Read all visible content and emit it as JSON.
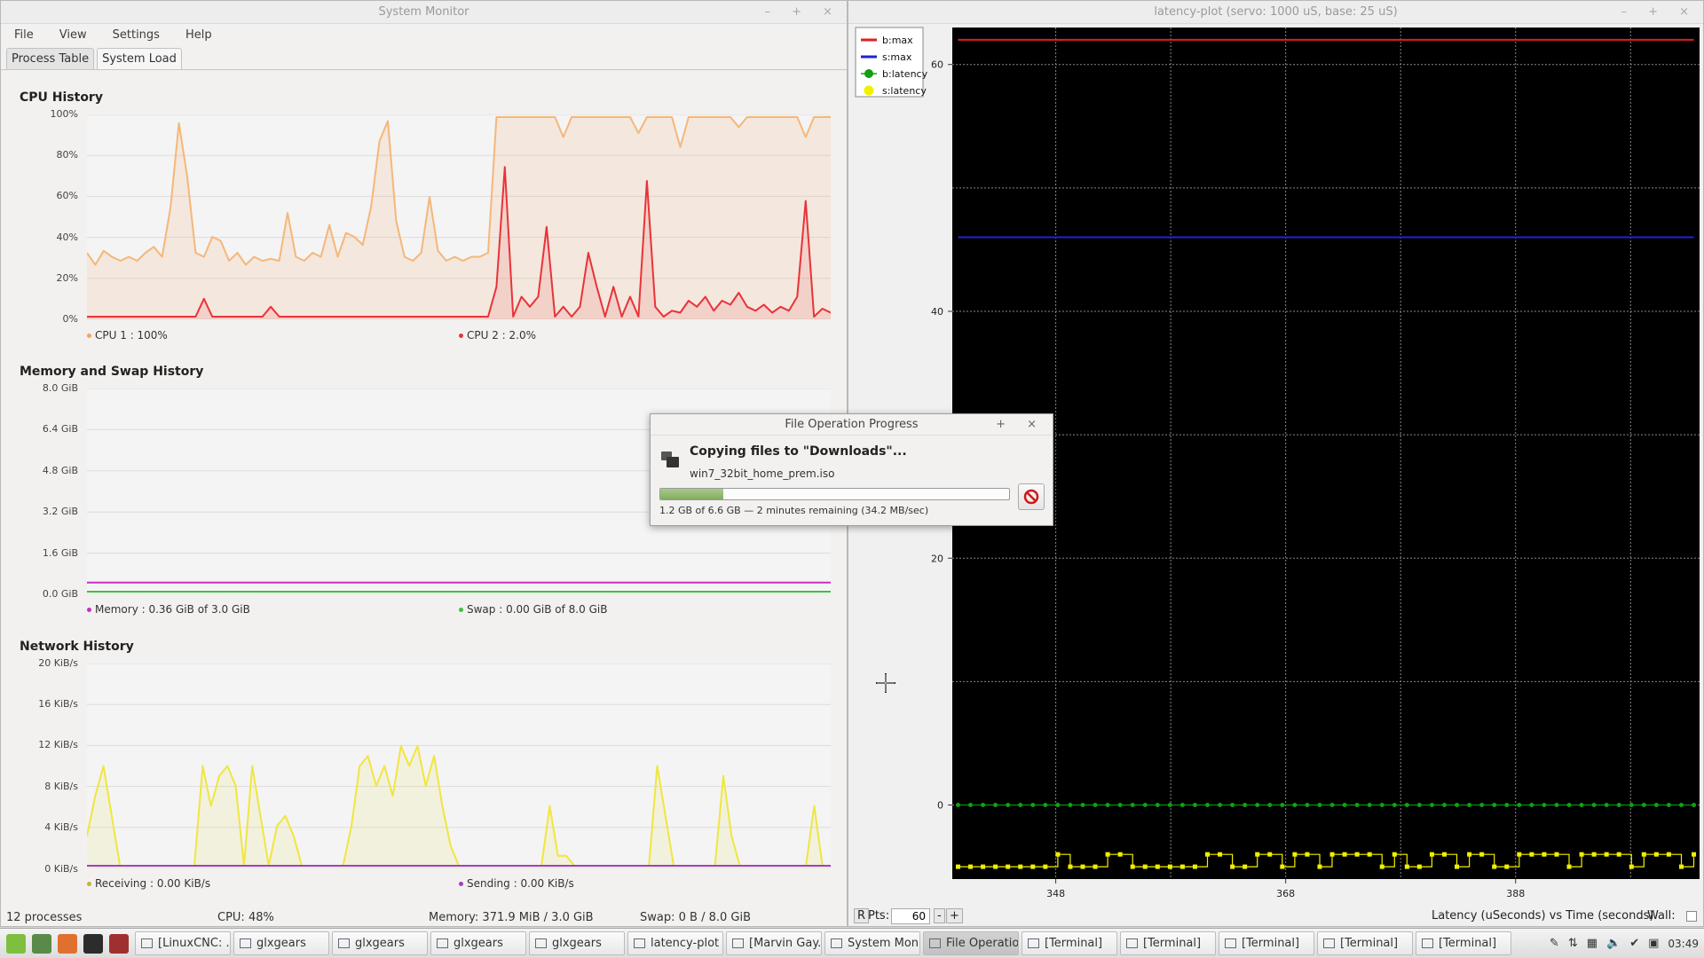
{
  "sysmon": {
    "title": "System Monitor",
    "menu": [
      "File",
      "View",
      "Settings",
      "Help"
    ],
    "tabs": [
      "Process Table",
      "System Load"
    ],
    "cpu": {
      "title": "CPU History",
      "yticks": [
        "100%",
        "80%",
        "60%",
        "40%",
        "20%",
        "0%"
      ],
      "legend1": "CPU 1 : 100%",
      "legend2": "CPU 2 : 2.0%",
      "color1": "#f5a35c",
      "color2": "#e8333a"
    },
    "memory": {
      "title": "Memory and Swap History",
      "yticks": [
        "8.0 GiB",
        "6.4 GiB",
        "4.8 GiB",
        "3.2 GiB",
        "1.6 GiB",
        "0.0 GiB"
      ],
      "legend1": "Memory : 0.36 GiB of 3.0 GiB",
      "legend2": "Swap : 0.00 GiB of 8.0 GiB",
      "color1": "#c62cc6",
      "color2": "#3ec03e"
    },
    "network": {
      "title": "Network History",
      "yticks": [
        "20 KiB/s",
        "16 KiB/s",
        "12 KiB/s",
        "8 KiB/s",
        "4 KiB/s",
        "0 KiB/s"
      ],
      "legend1": "Receiving : 0.00 KiB/s",
      "legend2": "Sending : 0.00 KiB/s",
      "color1": "#e8e03a",
      "color2": "#a040c0"
    },
    "status": {
      "processes": "12 processes",
      "cpu": "CPU: 48%",
      "memory": "Memory: 371.9 MiB / 3.0 GiB",
      "swap": "Swap: 0 B / 8.0 GiB"
    }
  },
  "dialog": {
    "title": "File Operation Progress",
    "heading": "Copying files to \"Downloads\"...",
    "filename": "win7_32bit_home_prem.iso",
    "progress": 0.18,
    "status": "1.2 GB of 6.6 GB — 2 minutes remaining (34.2 MB/sec)"
  },
  "latency": {
    "title": "latency-plot (servo: 1000 uS, base: 25 uS)",
    "legend": [
      {
        "label": "b:max",
        "color": "#e02020"
      },
      {
        "label": "s:max",
        "color": "#2020e0"
      },
      {
        "label": "b:latency",
        "color": "#10a010"
      },
      {
        "label": "s:latency",
        "color": "#f0f000"
      }
    ],
    "yticks": [
      "60",
      "40",
      "20",
      "0"
    ],
    "xticks": [
      "348",
      "368",
      "388"
    ],
    "r_button": "R",
    "pts_label": "Pts:",
    "pts_value": "60",
    "minus": "-",
    "plus": "+",
    "axis_caption": "Latency (uSeconds) vs Time (seconds)",
    "wall_label": "Wall:"
  },
  "chart_data": [
    {
      "type": "line",
      "title": "CPU History",
      "ylim": [
        0,
        100
      ],
      "series": [
        {
          "name": "CPU 1",
          "values": [
            32,
            26,
            33,
            30,
            28,
            30,
            28,
            32,
            35,
            30,
            55,
            97,
            70,
            32,
            30,
            40,
            38,
            28,
            32,
            26,
            30,
            28,
            29,
            28,
            52,
            30,
            28,
            32,
            30,
            46,
            30,
            42,
            40,
            36,
            55,
            88,
            98,
            48,
            30,
            28,
            32,
            60,
            33,
            28,
            30,
            28,
            30,
            30,
            32,
            100,
            100,
            100,
            100,
            100,
            100,
            100,
            100,
            90,
            100,
            100,
            100,
            100,
            100,
            100,
            100,
            100,
            92,
            100,
            100,
            100,
            100,
            85,
            100,
            100,
            100,
            100,
            100,
            100,
            95,
            100,
            100,
            100,
            100,
            100,
            100,
            100,
            90,
            100,
            100,
            100
          ]
        },
        {
          "name": "CPU 2",
          "values": [
            0,
            0,
            0,
            0,
            0,
            0,
            0,
            0,
            0,
            0,
            0,
            0,
            0,
            0,
            9,
            0,
            0,
            0,
            0,
            0,
            0,
            0,
            5,
            0,
            0,
            0,
            0,
            0,
            0,
            0,
            0,
            0,
            0,
            0,
            0,
            0,
            0,
            0,
            0,
            0,
            0,
            0,
            0,
            0,
            0,
            0,
            0,
            0,
            0,
            15,
            75,
            0,
            10,
            5,
            10,
            45,
            0,
            5,
            0,
            5,
            32,
            15,
            0,
            15,
            0,
            10,
            0,
            68,
            5,
            0,
            3,
            2,
            8,
            5,
            10,
            3,
            8,
            6,
            12,
            5,
            3,
            6,
            2,
            5,
            3,
            10,
            58,
            0,
            4,
            2
          ]
        }
      ]
    },
    {
      "type": "line",
      "title": "Memory and Swap History",
      "ylim": [
        0,
        8
      ],
      "series": [
        {
          "name": "Memory",
          "values": [
            0.36,
            0.36,
            0.36,
            0.36,
            0.36,
            0.36,
            0.36,
            0.36,
            0.36,
            0.36
          ]
        },
        {
          "name": "Swap",
          "values": [
            0.0,
            0.0,
            0.0,
            0.0,
            0.0,
            0.0,
            0.0,
            0.0,
            0.0,
            0.0
          ]
        }
      ]
    },
    {
      "type": "line",
      "title": "Network History",
      "ylim": [
        0,
        20
      ],
      "series": [
        {
          "name": "Receiving",
          "values": [
            3,
            7,
            10,
            5,
            0,
            0,
            0,
            0,
            0,
            0,
            0,
            0,
            0,
            0,
            10,
            6,
            9,
            10,
            8,
            0,
            10,
            5,
            0,
            4,
            5,
            3,
            0,
            0,
            0,
            0,
            0,
            0,
            4,
            10,
            11,
            8,
            10,
            7,
            12,
            10,
            12,
            8,
            11,
            6,
            2,
            0,
            0,
            0,
            0,
            0,
            0,
            0,
            0,
            0,
            0,
            0,
            6,
            1,
            1,
            0,
            0,
            0,
            0,
            0,
            0,
            0,
            0,
            0,
            0,
            10,
            5,
            0,
            0,
            0,
            0,
            0,
            0,
            9,
            3,
            0,
            0,
            0,
            0,
            0,
            0,
            0,
            0,
            0,
            6,
            0,
            0
          ]
        },
        {
          "name": "Sending",
          "values": [
            0,
            0,
            0,
            0,
            0,
            0,
            0,
            0,
            0,
            0
          ]
        }
      ]
    },
    {
      "type": "line",
      "title": "latency-plot (servo: 1000 uS, base: 25 uS)",
      "xlabel": "Time (seconds)",
      "ylabel": "Latency (uSeconds)",
      "xlim": [
        339,
        404
      ],
      "ylim": [
        -6,
        63
      ],
      "series": [
        {
          "name": "b:max",
          "values": [
            62,
            62,
            62,
            62,
            62,
            62,
            62,
            62,
            62,
            62
          ]
        },
        {
          "name": "s:max",
          "values": [
            46,
            46,
            46,
            46,
            46,
            46,
            46,
            46,
            46,
            46
          ]
        },
        {
          "name": "b:latency",
          "values": [
            0,
            0,
            0,
            0,
            0,
            0,
            0,
            0,
            0,
            0,
            0,
            0,
            0,
            0,
            0,
            0,
            0,
            0,
            0,
            0,
            0,
            0,
            0,
            0,
            0,
            0,
            0,
            0,
            0,
            0,
            0,
            0,
            0,
            0,
            0,
            0,
            0,
            0,
            0,
            0,
            0,
            0,
            0,
            0,
            0,
            0,
            0,
            0,
            0,
            0,
            0,
            0,
            0,
            0,
            0,
            0,
            0,
            0,
            0,
            0
          ]
        },
        {
          "name": "s:latency",
          "values": [
            -5,
            -5,
            -5,
            -5,
            -5,
            -5,
            -5,
            -5,
            -4,
            -5,
            -5,
            -5,
            -4,
            -4,
            -5,
            -5,
            -5,
            -5,
            -5,
            -5,
            -4,
            -4,
            -5,
            -5,
            -4,
            -4,
            -5,
            -4,
            -4,
            -5,
            -4,
            -4,
            -4,
            -4,
            -5,
            -4,
            -5,
            -5,
            -4,
            -4,
            -5,
            -4,
            -4,
            -5,
            -5,
            -4,
            -4,
            -4,
            -4,
            -5,
            -4,
            -4,
            -4,
            -4,
            -5,
            -4,
            -4,
            -4,
            -5,
            -4
          ]
        }
      ]
    }
  ],
  "taskbar": {
    "items": [
      "[LinuxCNC: ...",
      "glxgears",
      "glxgears",
      "glxgears",
      "glxgears",
      "latency-plot ...",
      "[Marvin Gay...",
      "System Mon...",
      "File Operatio...",
      "[Terminal]",
      "[Terminal]",
      "[Terminal]",
      "[Terminal]",
      "[Terminal]"
    ],
    "active_index": 8,
    "clock": "03:49"
  }
}
